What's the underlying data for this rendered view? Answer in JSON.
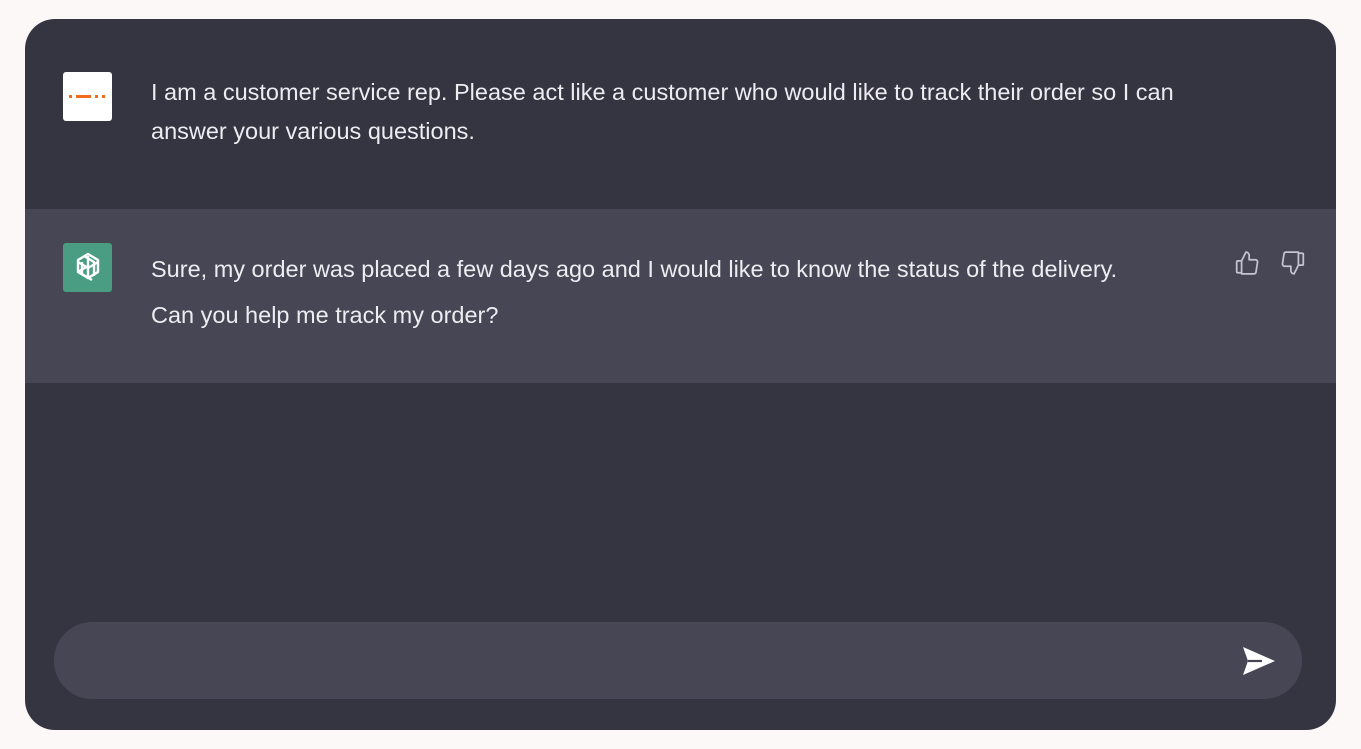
{
  "conversation": {
    "messages": [
      {
        "role": "user",
        "avatar_icon": "dash-logo-icon",
        "text": "I am a customer service rep. Please act like a customer who would like to track their order so I can answer your various questions."
      },
      {
        "role": "assistant",
        "avatar_icon": "openai-logo-icon",
        "text": "Sure, my order was placed a few days ago and I would like to know the status of the delivery. Can you help me track my order?"
      }
    ]
  },
  "feedback": {
    "thumbs_up_icon": "thumbs-up-icon",
    "thumbs_down_icon": "thumbs-down-icon"
  },
  "composer": {
    "value": "",
    "placeholder": "",
    "send_icon": "send-icon"
  },
  "colors": {
    "page_background": "#fdf8f8",
    "window_background": "#353441",
    "assistant_row_background": "#464655",
    "assistant_avatar": "#4a9d82",
    "user_avatar_accent": "#f26a1b",
    "text": "#ececf1"
  }
}
